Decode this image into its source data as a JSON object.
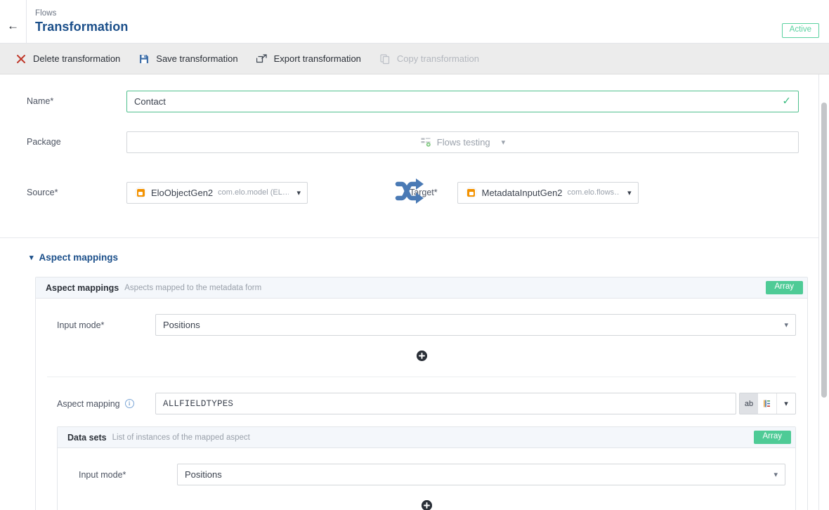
{
  "header": {
    "breadcrumb": "Flows",
    "title": "Transformation",
    "status": "Active",
    "back_icon": "arrow-left-icon"
  },
  "toolbar": {
    "items": [
      {
        "label": "Delete transformation",
        "icon": "close-x-icon",
        "disabled": false
      },
      {
        "label": "Save transformation",
        "icon": "save-disk-icon",
        "disabled": false
      },
      {
        "label": "Export transformation",
        "icon": "external-link-icon",
        "disabled": false
      },
      {
        "label": "Copy transformation",
        "icon": "copy-icon",
        "disabled": true
      }
    ]
  },
  "form": {
    "name": {
      "label": "Name*",
      "value": "Contact",
      "valid_icon": "check-icon"
    },
    "package": {
      "label": "Package",
      "value": "Flows testing",
      "icon": "package-icon",
      "chevron": "chevron-down-icon"
    },
    "source": {
      "label": "Source*",
      "name": "EloObjectGen2",
      "namespace": "com.elo.model (EL…",
      "icon": "object-orange-icon",
      "chevron": "chevron-down-icon"
    },
    "target": {
      "label": "Target*",
      "name": "MetadataInputGen2",
      "namespace": "com.elo.flows…",
      "icon": "object-orange-icon",
      "chevron": "chevron-down-icon"
    },
    "transform_icon": "shuffle-icon"
  },
  "aspect_section": {
    "heading": "Aspect mappings",
    "chevron": "chevron-down-icon",
    "panel": {
      "title": "Aspect mappings",
      "description": "Aspects mapped to the metadata form",
      "badge": "Array",
      "input_mode": {
        "label": "Input mode*",
        "value": "Positions",
        "chevron": "chevron-down-icon"
      },
      "add_icon": "plus-circle-icon",
      "mapping": {
        "label": "Aspect mapping",
        "info_icon": "info-icon",
        "value": "ALLFIELDTYPES",
        "mode_text": "ab",
        "mode_json": "json-icon",
        "chevron": "chevron-down-icon"
      },
      "datasets": {
        "title": "Data sets",
        "description": "List of instances of the mapped aspect",
        "badge": "Array",
        "input_mode": {
          "label": "Input mode*",
          "value": "Positions",
          "chevron": "chevron-down-icon"
        },
        "add_icon": "plus-circle-icon"
      }
    }
  },
  "colors": {
    "accent_blue": "#1b4f8a",
    "green": "#4ecb96",
    "orange": "#f39200",
    "shuffle_blue": "#4a7ab5"
  }
}
